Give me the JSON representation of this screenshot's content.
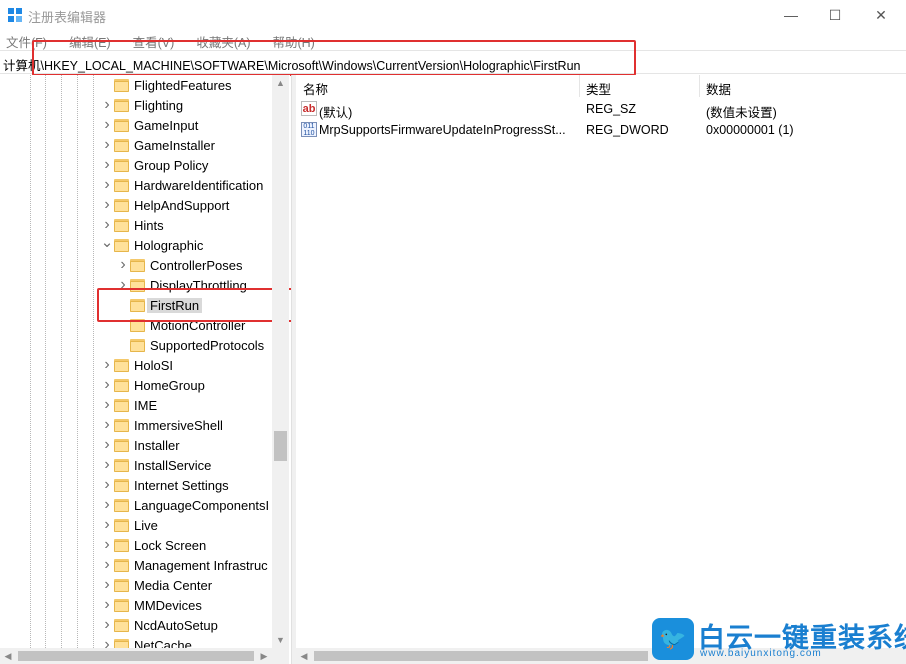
{
  "window": {
    "title": "注册表编辑器",
    "minimize_glyph": "—",
    "maximize_glyph": "☐",
    "close_glyph": "✕"
  },
  "menu": [
    "文件(F)",
    "编辑(E)",
    "查看(V)",
    "收藏夹(A)",
    "帮助(H)"
  ],
  "address": {
    "path": "计算机\\HKEY_LOCAL_MACHINE\\SOFTWARE\\Microsoft\\Windows\\CurrentVersion\\Holographic\\FirstRun"
  },
  "tree": {
    "items": [
      {
        "label": "FlightedFeatures",
        "level": 1,
        "expander": "none"
      },
      {
        "label": "Flighting",
        "level": 1,
        "expander": "collapsed"
      },
      {
        "label": "GameInput",
        "level": 1,
        "expander": "collapsed"
      },
      {
        "label": "GameInstaller",
        "level": 1,
        "expander": "collapsed"
      },
      {
        "label": "Group Policy",
        "level": 1,
        "expander": "collapsed"
      },
      {
        "label": "HardwareIdentification",
        "level": 1,
        "expander": "collapsed"
      },
      {
        "label": "HelpAndSupport",
        "level": 1,
        "expander": "collapsed"
      },
      {
        "label": "Hints",
        "level": 1,
        "expander": "collapsed"
      },
      {
        "label": "Holographic",
        "level": 1,
        "expander": "expanded"
      },
      {
        "label": "ControllerPoses",
        "level": 2,
        "expander": "collapsed"
      },
      {
        "label": "DisplayThrottling",
        "level": 2,
        "expander": "collapsed"
      },
      {
        "label": "FirstRun",
        "level": 2,
        "expander": "none",
        "selected": true
      },
      {
        "label": "MotionController",
        "level": 2,
        "expander": "none"
      },
      {
        "label": "SupportedProtocols",
        "level": 2,
        "expander": "none"
      },
      {
        "label": "HoloSI",
        "level": 1,
        "expander": "collapsed"
      },
      {
        "label": "HomeGroup",
        "level": 1,
        "expander": "collapsed"
      },
      {
        "label": "IME",
        "level": 1,
        "expander": "collapsed"
      },
      {
        "label": "ImmersiveShell",
        "level": 1,
        "expander": "collapsed"
      },
      {
        "label": "Installer",
        "level": 1,
        "expander": "collapsed"
      },
      {
        "label": "InstallService",
        "level": 1,
        "expander": "collapsed"
      },
      {
        "label": "Internet Settings",
        "level": 1,
        "expander": "collapsed"
      },
      {
        "label": "LanguageComponentsI",
        "level": 1,
        "expander": "collapsed"
      },
      {
        "label": "Live",
        "level": 1,
        "expander": "collapsed"
      },
      {
        "label": "Lock Screen",
        "level": 1,
        "expander": "collapsed"
      },
      {
        "label": "Management Infrastruc",
        "level": 1,
        "expander": "collapsed"
      },
      {
        "label": "Media Center",
        "level": 1,
        "expander": "collapsed"
      },
      {
        "label": "MMDevices",
        "level": 1,
        "expander": "collapsed"
      },
      {
        "label": "NcdAutoSetup",
        "level": 1,
        "expander": "collapsed"
      },
      {
        "label": "NetCache",
        "level": 1,
        "expander": "collapsed"
      }
    ]
  },
  "values": {
    "columns": {
      "name": "名称",
      "type": "类型",
      "data": "数据"
    },
    "rows": [
      {
        "icon": "string-value-icon",
        "icon_glyph": "ab",
        "name": "(默认)",
        "type": "REG_SZ",
        "data": "(数值未设置)"
      },
      {
        "icon": "binary-value-icon",
        "icon_glyph": "011 110",
        "name": "MrpSupportsFirmwareUpdateInProgressSt...",
        "type": "REG_DWORD",
        "data": "0x00000001 (1)"
      }
    ]
  },
  "watermark": {
    "title": "白云一键重装系统",
    "url": "www.baiyunxitong.com"
  },
  "colors": {
    "highlight_box": "#e03030",
    "selection": "#d9d9d9",
    "folder": "#ffe19a",
    "watermark": "#1a7fd0"
  }
}
